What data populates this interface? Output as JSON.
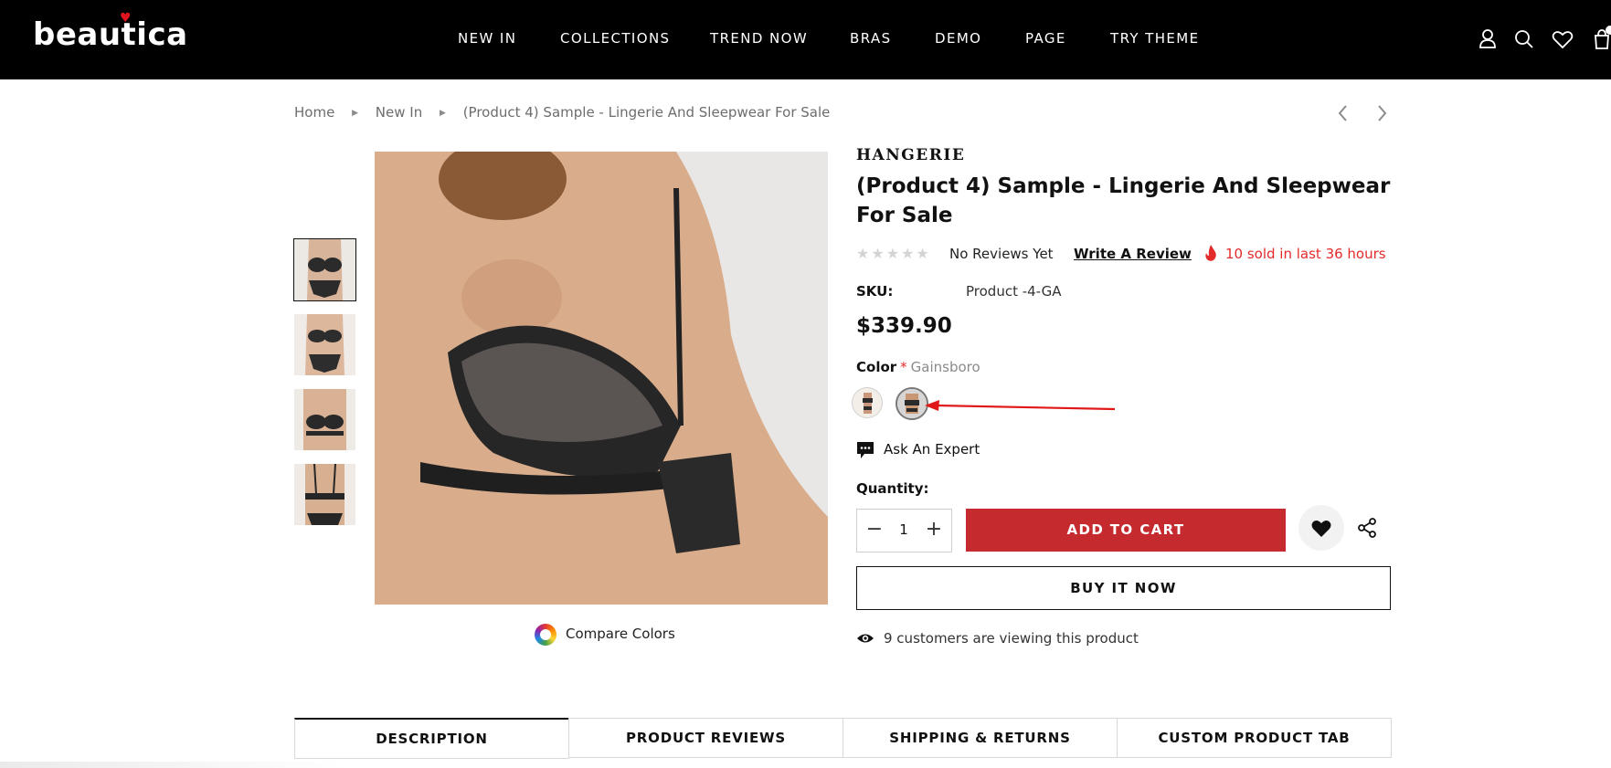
{
  "header": {
    "logo": "beautica",
    "nav": [
      "NEW IN",
      "COLLECTIONS",
      "TREND NOW",
      "BRAS",
      "DEMO",
      "PAGE",
      "TRY THEME"
    ],
    "icons": [
      "user-icon",
      "search-icon",
      "heart-icon",
      "cart-icon"
    ]
  },
  "breadcrumb": {
    "items": [
      "Home",
      "New In",
      "(Product 4) Sample - Lingerie And Sleepwear For Sale"
    ]
  },
  "gallery": {
    "thumbnails": 4,
    "compare_label": "Compare Colors"
  },
  "product": {
    "vendor": "HANGERIE",
    "title": "(Product 4) Sample - Lingerie And Sleepwear For Sale",
    "rating_stars": 0,
    "reviews_text": "No Reviews Yet",
    "write_review": "Write A Review",
    "sold_text": "10 sold in last 36 hours",
    "sku_label": "SKU:",
    "sku_value": "Product -4-GA",
    "price": "$339.90",
    "color_label": "Color",
    "color_required": "*",
    "color_value": "Gainsboro",
    "ask_expert": "Ask An Expert",
    "quantity_label": "Quantity:",
    "quantity_value": "1",
    "add_to_cart": "ADD TO CART",
    "buy_now": "BUY IT NOW",
    "viewing_text": "9 customers are viewing this product"
  },
  "tabs": [
    "DESCRIPTION",
    "PRODUCT REVIEWS",
    "SHIPPING & RETURNS",
    "CUSTOM PRODUCT TAB"
  ],
  "colors": {
    "header_bg": "#000000",
    "accent_red": "#c42a2e",
    "sold_red": "#e32b2b"
  }
}
